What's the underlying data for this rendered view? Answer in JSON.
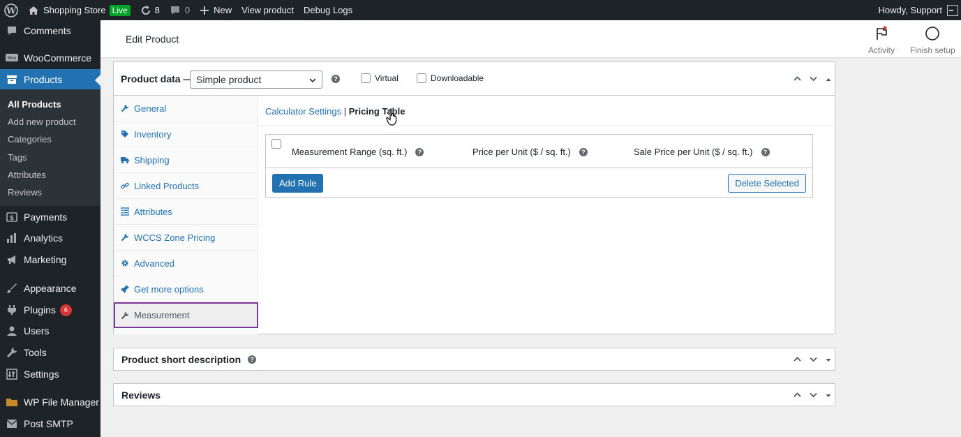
{
  "admin_bar": {
    "site_name": "Shopping Store",
    "live_badge": "Live",
    "updates_count": "8",
    "comments_count": "0",
    "new_label": "New",
    "view_product": "View product",
    "debug_logs": "Debug Logs",
    "greeting": "Howdy, Support"
  },
  "sidebar": {
    "items": [
      {
        "label": "Comments",
        "icon": "comments-icon"
      },
      {
        "label": "WooCommerce",
        "icon": "woo-icon"
      },
      {
        "label": "Products",
        "icon": "archive-icon"
      },
      {
        "label": "Payments",
        "icon": "money-icon"
      },
      {
        "label": "Analytics",
        "icon": "chart-icon"
      },
      {
        "label": "Marketing",
        "icon": "megaphone-icon"
      },
      {
        "label": "Appearance",
        "icon": "brush-icon"
      },
      {
        "label": "Plugins",
        "icon": "plugin-icon",
        "badge": "6"
      },
      {
        "label": "Users",
        "icon": "users-icon"
      },
      {
        "label": "Tools",
        "icon": "wrench-icon"
      },
      {
        "label": "Settings",
        "icon": "settings-icon"
      },
      {
        "label": "WP File Manager",
        "icon": "folder-icon"
      },
      {
        "label": "Post SMTP",
        "icon": "email-icon"
      }
    ],
    "submenu": [
      "All Products",
      "Add new product",
      "Categories",
      "Tags",
      "Attributes",
      "Reviews"
    ]
  },
  "header": {
    "title": "Edit Product",
    "activity": "Activity",
    "finish_setup": "Finish setup"
  },
  "product_data": {
    "title": "Product data —",
    "type_selected": "Simple product",
    "virtual": "Virtual",
    "downloadable": "Downloadable",
    "tabs": [
      "General",
      "Inventory",
      "Shipping",
      "Linked Products",
      "Attributes",
      "WCCS Zone Pricing",
      "Advanced",
      "Get more options",
      "Measurement"
    ],
    "sub_tabs": {
      "calculator": "Calculator Settings",
      "separator": "|",
      "pricing": "Pricing Table"
    },
    "columns": [
      "Measurement Range (sq. ft.)",
      "Price per Unit ($ / sq. ft.)",
      "Sale Price per Unit ($ / sq. ft.)"
    ],
    "add_rule": "Add Rule",
    "delete_selected": "Delete Selected"
  },
  "short_description": {
    "title": "Product short description"
  },
  "reviews": {
    "title": "Reviews"
  },
  "colors": {
    "accent": "#2271b1",
    "adminbar": "#1d2327",
    "active_tab_border": "#7e3794",
    "live": "#00a32a"
  }
}
